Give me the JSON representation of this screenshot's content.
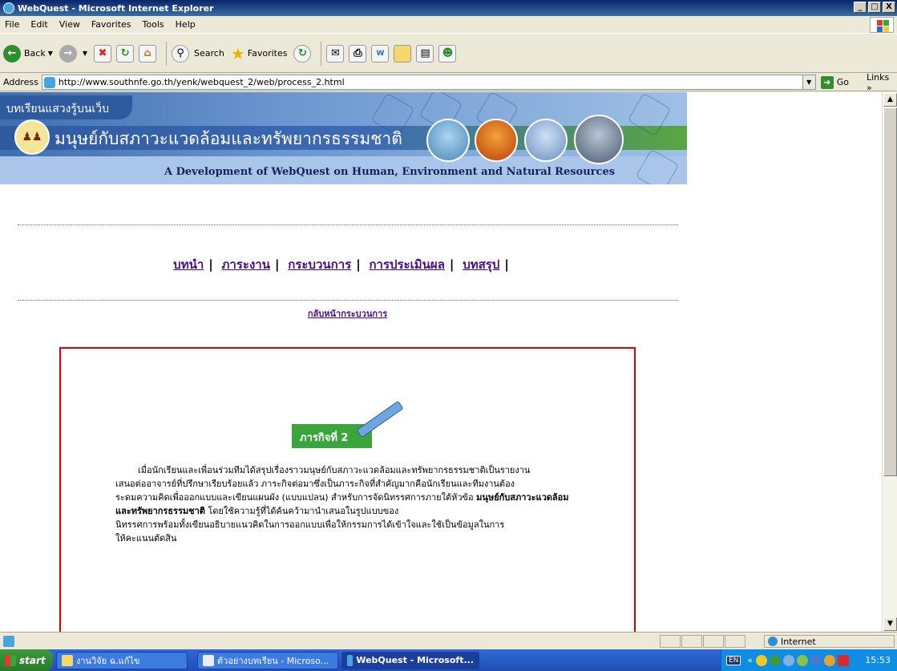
{
  "window": {
    "title": "WebQuest - Microsoft Internet Explorer",
    "controls": [
      "_",
      "□",
      "X"
    ]
  },
  "menu": [
    "File",
    "Edit",
    "View",
    "Favorites",
    "Tools",
    "Help"
  ],
  "toolbar": {
    "back_label": "Back",
    "search_label": "Search",
    "favorites_label": "Favorites"
  },
  "address": {
    "label": "Address",
    "url": "http://www.southnfe.go.th/yenk/webquest_2/web/process_2.html",
    "go_label": "Go",
    "links_label": "Links »"
  },
  "page": {
    "banner_tag": "บทเรียนแสวงรู้บนเว็บ",
    "banner_thai_title": "มนุษย์กับสภาวะแวดล้อมและทรัพยากรธรรมชาติ",
    "banner_en_title": "A Development of WebQuest on Human, Environment and Natural Resources",
    "nav": [
      {
        "label": "บทนำ"
      },
      {
        "label": "ภาระงาน"
      },
      {
        "label": "กระบวนการ"
      },
      {
        "label": "การประเมินผล"
      },
      {
        "label": "บทสรุป"
      }
    ],
    "back_link": "กลับหน้ากระบวนการ",
    "mission_label": "ภารกิจที่ 2",
    "body_lines": [
      "เมื่อนักเรียนและเพื่อนร่วมทีมได้สรุปเรื่องราวมนุษย์กับสภาวะแวดล้อมและทรัพยากรธรรมชาติเป็นรายงาน",
      "เสนอต่ออาจารย์ที่ปรึกษาเรียบร้อยแล้ว ภาระกิจต่อมาซึ่งเป็นภาระกิจที่สำคัญมากคือนักเรียนและทีมงานต้อง",
      "ระดมความคิดเพื่อออกแบบและเขียนแผนผัง (แบบแปลน) สำหรับการจัดนิทรรศการภายใต้หัวข้อ",
      "มนุษย์กับสภาวะแวดล้อมและทรัพยากรธรรมชาติ",
      "โดยใช้ความรู้ที่ได้ค้นคว้ามานำเสนอในรูปแบบของ",
      "นิทรรศการพร้อมทั้งเขียนอธิบายแนวคิดในการออกแบบเพื่อให้กรรมการได้เข้าใจและใช้เป็นข้อมูลในการ",
      "ให้คะแนนตัดสิน"
    ]
  },
  "statusbar": {
    "zone": "Internet"
  },
  "taskbar": {
    "start_label": "start",
    "tasks": [
      {
        "label": "งานวิจัย ฉ.แก้ไข"
      },
      {
        "label": "ตัวอย่างบทเรียน - Microso..."
      },
      {
        "label": "WebQuest - Microsoft..."
      }
    ],
    "lang": "EN",
    "clock": "15:53"
  }
}
